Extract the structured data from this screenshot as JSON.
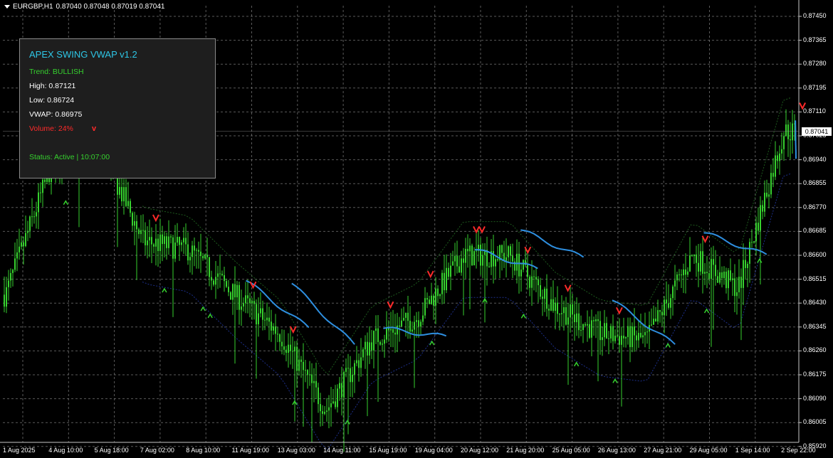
{
  "header": {
    "symbol": "EURGBP,H1",
    "ohlc": "0.87040 0.87048 0.87019 0.87041"
  },
  "panel": {
    "title": "APEX SWING VWAP v1.2",
    "trend": "Trend: BULLISH",
    "high": "High: 0.87121",
    "low": "Low: 0.86724",
    "vwap": "VWAP: 0.86975",
    "volume": "Volume: 24%",
    "volume_marker": "v",
    "status": "Status: Active | 10:07:00"
  },
  "colors": {
    "background": "#000000",
    "grid": "#8a8a8a",
    "candles": "#36d12e",
    "vwap_line": "#2e8fe0",
    "sell_arrow": "#ff2a2a",
    "buy_arrow": "#36d12e",
    "panel_title": "#2ec6e6",
    "trend_text": "#36d12e",
    "volume_text": "#ff2a2a"
  },
  "price_axis": {
    "labels": [
      "0.87450",
      "0.87365",
      "0.87280",
      "0.87195",
      "0.87110",
      "0.87025",
      "0.86940",
      "0.86855",
      "0.86770",
      "0.86685",
      "0.86600",
      "0.86515",
      "0.86430",
      "0.86345",
      "0.86260",
      "0.86175",
      "0.86090",
      "0.86005",
      "0.85920"
    ],
    "current_price": "0.87041"
  },
  "time_axis": {
    "labels": [
      "1 Aug 2025",
      "4 Aug 10:00",
      "5 Aug 18:00",
      "7 Aug 02:00",
      "8 Aug 10:00",
      "11 Aug 19:00",
      "13 Aug 03:00",
      "14 Aug 11:00",
      "15 Aug 19:00",
      "19 Aug 04:00",
      "20 Aug 12:00",
      "21 Aug 20:00",
      "25 Aug 05:00",
      "26 Aug 13:00",
      "27 Aug 21:00",
      "29 Aug 05:00",
      "1 Sep 14:00",
      "2 Sep 22:00"
    ]
  },
  "chart_data": {
    "type": "candlestick",
    "symbol": "EURGBP",
    "timeframe": "H1",
    "y_range": [
      0.8592,
      0.8747
    ],
    "price_path": [
      {
        "t": "1 Aug 2025",
        "price": 0.8646
      },
      {
        "t": "4 Aug 10:00",
        "price": 0.8692
      },
      {
        "t": "5 Aug 18:00",
        "price": 0.8701
      },
      {
        "t": "7 Aug 02:00",
        "price": 0.8665
      },
      {
        "t": "8 Aug 10:00",
        "price": 0.8662
      },
      {
        "t": "11 Aug 19:00",
        "price": 0.8646
      },
      {
        "t": "13 Aug 03:00",
        "price": 0.8632
      },
      {
        "t": "14 Aug 11:00",
        "price": 0.8605
      },
      {
        "t": "15 Aug 19:00",
        "price": 0.863
      },
      {
        "t": "19 Aug 04:00",
        "price": 0.8638
      },
      {
        "t": "20 Aug 12:00",
        "price": 0.866
      },
      {
        "t": "21 Aug 20:00",
        "price": 0.866
      },
      {
        "t": "25 Aug 05:00",
        "price": 0.8642
      },
      {
        "t": "26 Aug 13:00",
        "price": 0.8632
      },
      {
        "t": "27 Aug 21:00",
        "price": 0.863
      },
      {
        "t": "29 Aug 05:00",
        "price": 0.866
      },
      {
        "t": "1 Sep 14:00",
        "price": 0.8648
      },
      {
        "t": "2 Sep 22:00",
        "price": 0.8704
      }
    ],
    "vwap_segments": [
      [
        [
          "11 Aug 19:00",
          0.8651
        ],
        [
          "13 Aug 03:00",
          0.8634
        ]
      ],
      [
        [
          "13 Aug 03:00",
          0.865
        ],
        [
          "14 Aug 11:00",
          0.8628
        ]
      ],
      [
        [
          "15 Aug 19:00",
          0.8634
        ],
        [
          "19 Aug 04:00",
          0.8631
        ]
      ],
      [
        [
          "20 Aug 12:00",
          0.8662
        ],
        [
          "21 Aug 20:00",
          0.8655
        ]
      ],
      [
        [
          "21 Aug 20:00",
          0.8669
        ],
        [
          "25 Aug 05:00",
          0.8659
        ]
      ],
      [
        [
          "26 Aug 13:00",
          0.8644
        ],
        [
          "27 Aug 21:00",
          0.8628
        ]
      ],
      [
        [
          "29 Aug 05:00",
          0.8668
        ],
        [
          "1 Sep 14:00",
          0.866
        ]
      ],
      [
        [
          "2 Sep 22:00",
          0.8708
        ],
        [
          "2 Sep 22:00",
          0.8694
        ]
      ]
    ],
    "sell_signals": [
      "7 Aug 02:00",
      "11 Aug 19:00",
      "13 Aug 03:00",
      "15 Aug 19:00",
      "19 Aug 04:00",
      "20 Aug 12:00",
      "20 Aug 12:00",
      "21 Aug 20:00",
      "25 Aug 05:00",
      "26 Aug 13:00",
      "29 Aug 05:00",
      "2 Sep 22:00"
    ],
    "buy_signals": [
      "4 Aug 10:00",
      "7 Aug 02:00",
      "8 Aug 10:00",
      "8 Aug 10:00",
      "13 Aug 03:00",
      "14 Aug 11:00",
      "19 Aug 04:00",
      "20 Aug 12:00",
      "21 Aug 20:00",
      "25 Aug 05:00",
      "26 Aug 13:00",
      "27 Aug 21:00",
      "29 Aug 05:00",
      "1 Sep 14:00"
    ],
    "current_price": 0.87041
  }
}
